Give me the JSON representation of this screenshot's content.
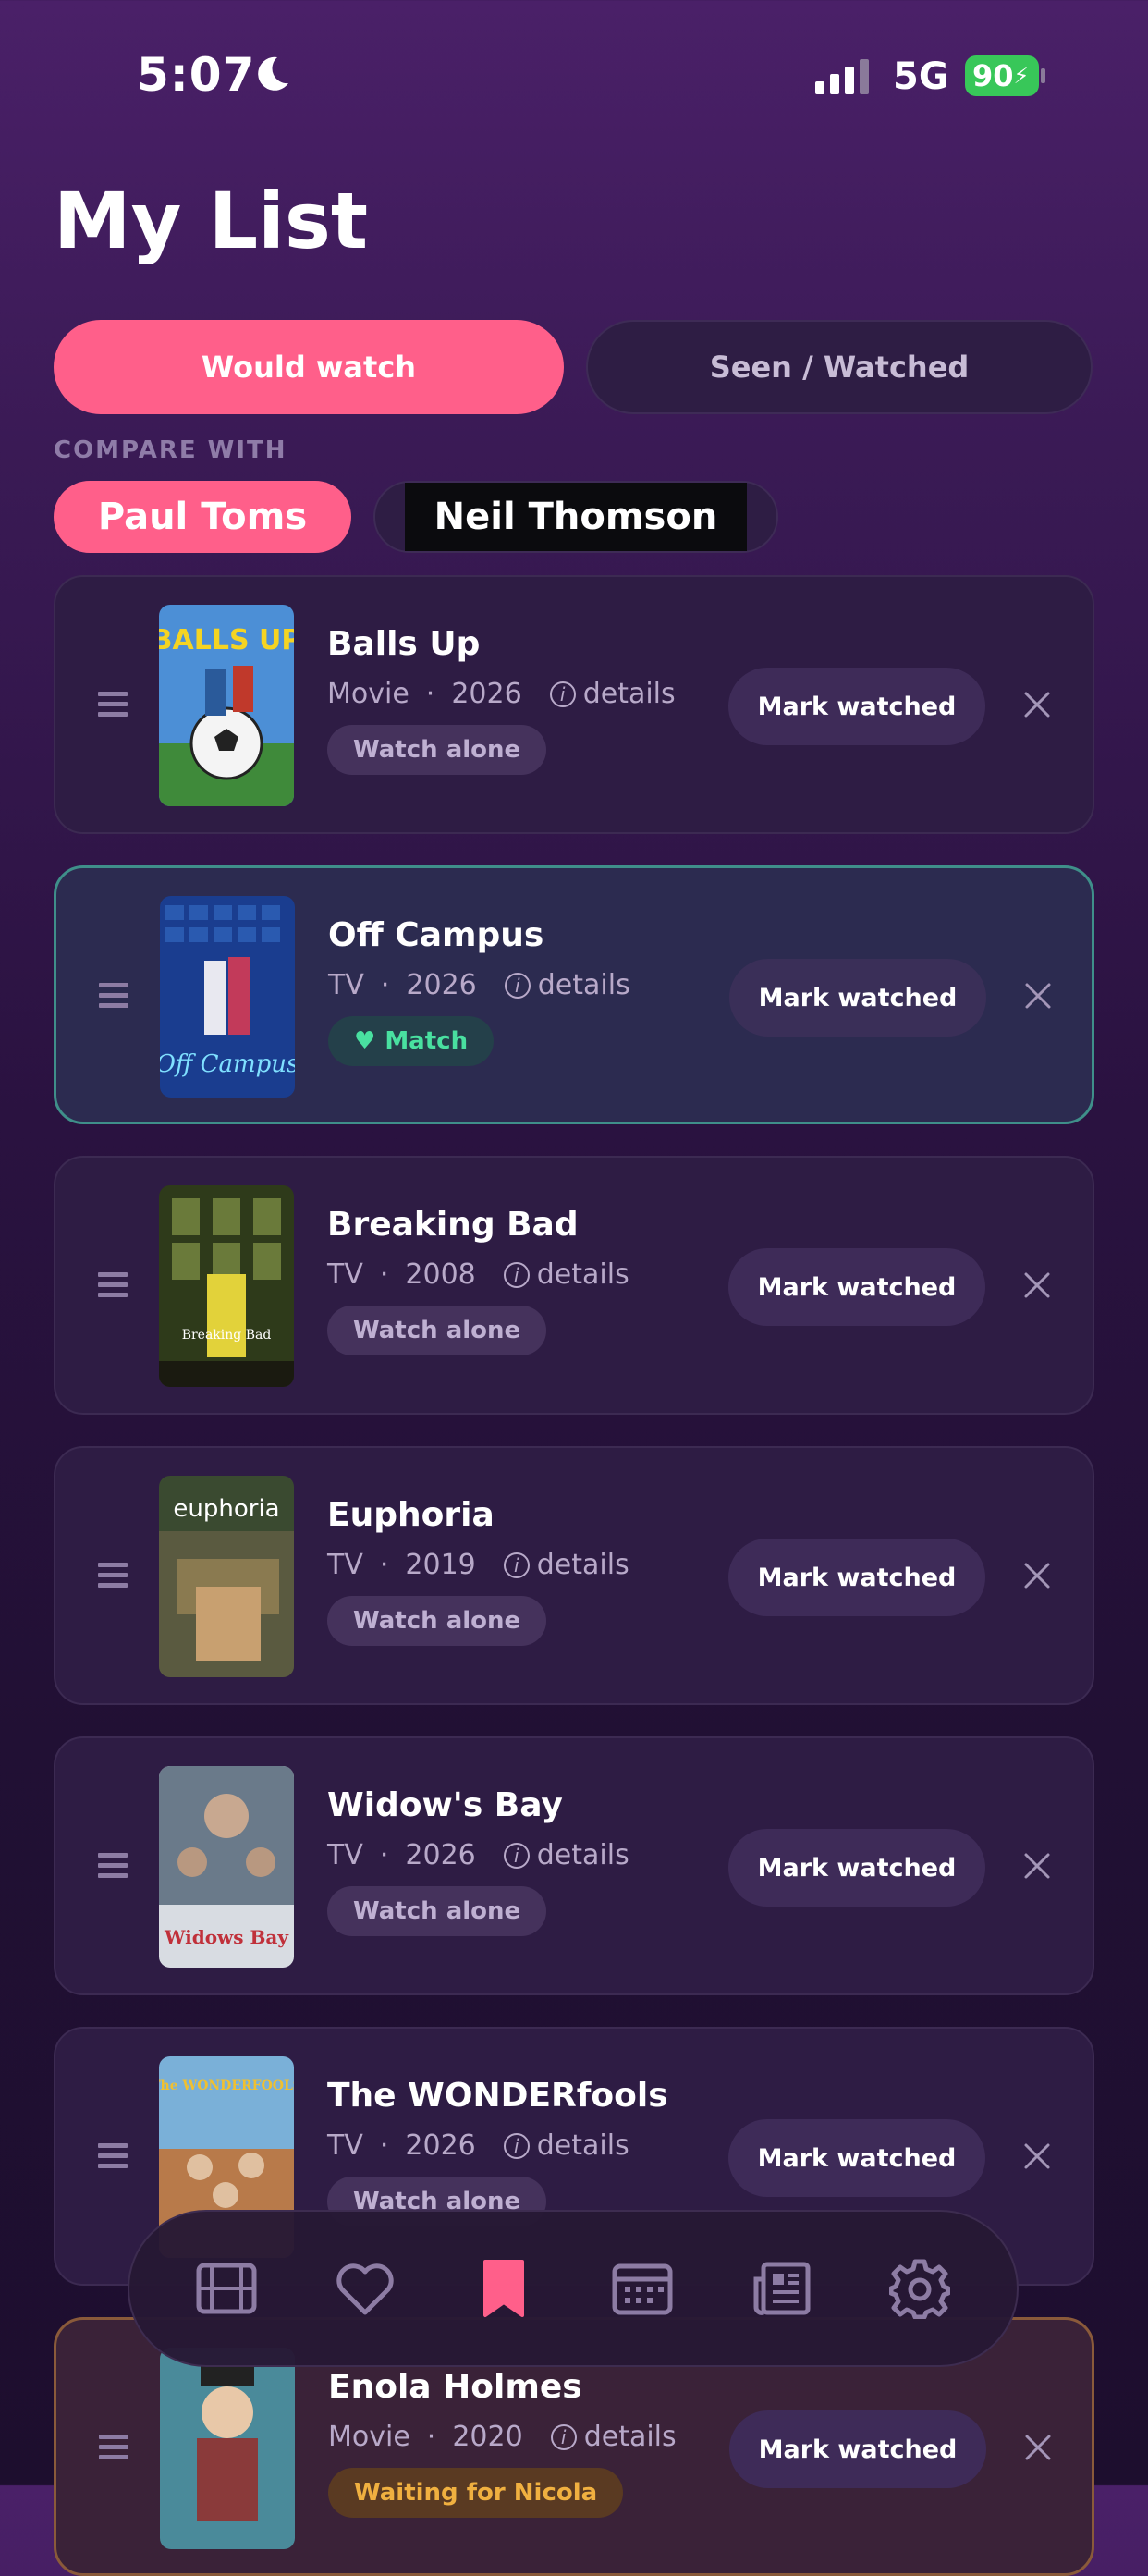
{
  "status_bar": {
    "time": "5:07",
    "network": "5G",
    "battery": "90"
  },
  "page": {
    "title": "My List"
  },
  "segments": {
    "would_watch": "Would watch",
    "seen_watched": "Seen / Watched"
  },
  "compare": {
    "label": "COMPARE WITH",
    "people": [
      "Paul Toms",
      "Neil Thomson"
    ]
  },
  "common": {
    "details": "details",
    "mark_watched": "Mark watched"
  },
  "items": [
    {
      "title": "Balls Up",
      "type": "Movie",
      "year": "2026",
      "badge": "Watch alone"
    },
    {
      "title": "Off Campus",
      "type": "TV",
      "year": "2026",
      "badge": "Match"
    },
    {
      "title": "Breaking Bad",
      "type": "TV",
      "year": "2008",
      "badge": "Watch alone"
    },
    {
      "title": "Euphoria",
      "type": "TV",
      "year": "2019",
      "badge": "Watch alone"
    },
    {
      "title": "Widow's Bay",
      "type": "TV",
      "year": "2026",
      "badge": "Watch alone"
    },
    {
      "title": "The WONDERfools",
      "type": "TV",
      "year": "2026",
      "badge": "Watch alone"
    },
    {
      "title": "Enola Holmes",
      "type": "Movie",
      "year": "2020",
      "badge": "Waiting for Nicola"
    }
  ],
  "posters": [
    {
      "text": "BALLS UP"
    },
    {
      "text": "Off Campus"
    },
    {
      "text": "Breaking Bad"
    },
    {
      "text": "euphoria"
    },
    {
      "text": "Widows Bay"
    },
    {
      "text": "The WONDERFOOLS"
    },
    {
      "text": ""
    }
  ],
  "colors": {
    "accent": "#ff5f8a",
    "match_green": "#49e0a0",
    "match_border": "#3f8f8a",
    "waiting_amber": "#f0b040"
  },
  "nav": {
    "tabs": [
      "film-icon",
      "heart-icon",
      "bookmark-icon",
      "calendar-icon",
      "news-icon",
      "settings-icon"
    ],
    "active": "bookmark-icon"
  }
}
